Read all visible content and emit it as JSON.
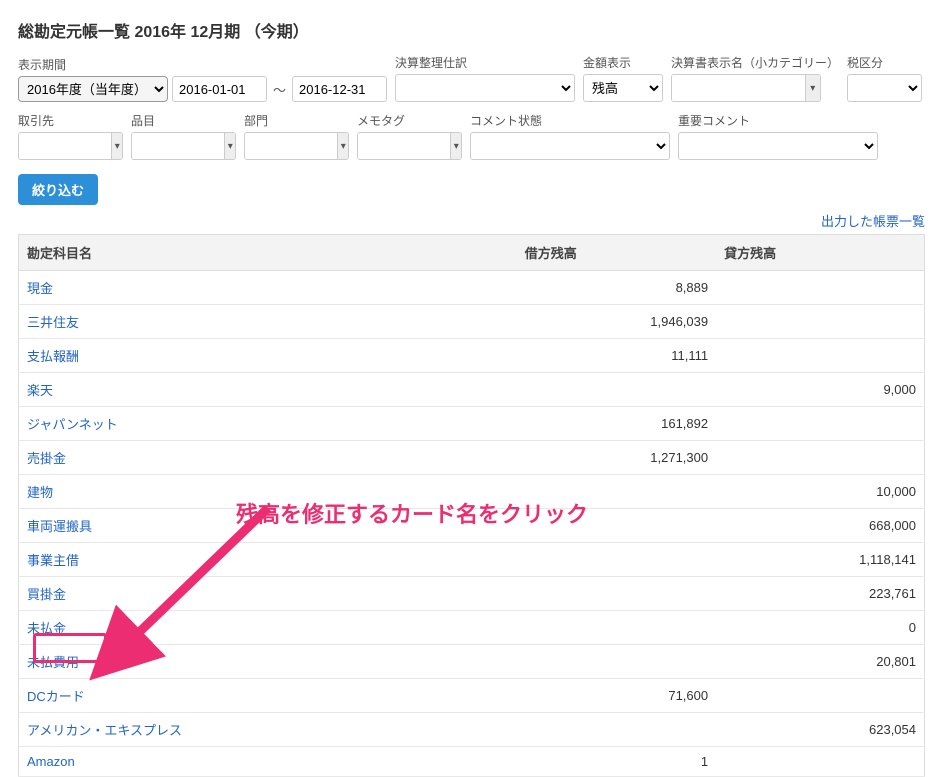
{
  "page_title": "総勘定元帳一覧 2016年 12月期 （今期）",
  "filters_row1": {
    "display_period": {
      "label": "表示期間",
      "fiscal_year": "2016年度（当年度）",
      "from": "2016-01-01",
      "to": "2016-12-31"
    },
    "closing_adjustment": {
      "label": "決算整理仕訳",
      "value": ""
    },
    "amount_display": {
      "label": "金額表示",
      "value": "残高"
    },
    "report_display_name": {
      "label": "決算書表示名（小カテゴリー）",
      "value": ""
    },
    "tax_division": {
      "label": "税区分",
      "value": ""
    }
  },
  "filters_row2": {
    "partner": {
      "label": "取引先",
      "value": ""
    },
    "item": {
      "label": "品目",
      "value": ""
    },
    "section": {
      "label": "部門",
      "value": ""
    },
    "memo_tag": {
      "label": "メモタグ",
      "value": ""
    },
    "comment_status": {
      "label": "コメント状態",
      "value": ""
    },
    "important_comment": {
      "label": "重要コメント",
      "value": ""
    }
  },
  "filter_button": "絞り込む",
  "exported_reports_link": "出力した帳票一覧",
  "table": {
    "columns": {
      "name": "勘定科目名",
      "debit": "借方残高",
      "credit": "貸方残高"
    },
    "rows": [
      {
        "name": "現金",
        "debit": "8,889",
        "credit": ""
      },
      {
        "name": "三井住友",
        "debit": "1,946,039",
        "credit": ""
      },
      {
        "name": "支払報酬",
        "debit": "11,111",
        "credit": ""
      },
      {
        "name": "楽天",
        "debit": "",
        "credit": "9,000"
      },
      {
        "name": "ジャパンネット",
        "debit": "161,892",
        "credit": ""
      },
      {
        "name": "売掛金",
        "debit": "1,271,300",
        "credit": ""
      },
      {
        "name": "建物",
        "debit": "",
        "credit": "10,000"
      },
      {
        "name": "車両運搬具",
        "debit": "",
        "credit": "668,000"
      },
      {
        "name": "事業主借",
        "debit": "",
        "credit": "1,118,141"
      },
      {
        "name": "買掛金",
        "debit": "",
        "credit": "223,761"
      },
      {
        "name": "未払金",
        "debit": "",
        "credit": "0"
      },
      {
        "name": "未払費用",
        "debit": "",
        "credit": "20,801"
      },
      {
        "name": "DCカード",
        "debit": "71,600",
        "credit": ""
      },
      {
        "name": "アメリカン・エキスプレス",
        "debit": "",
        "credit": "623,054"
      },
      {
        "name": "Amazon",
        "debit": "1",
        "credit": ""
      }
    ]
  },
  "annotation": {
    "text": "残高を修正するカード名をクリック"
  }
}
